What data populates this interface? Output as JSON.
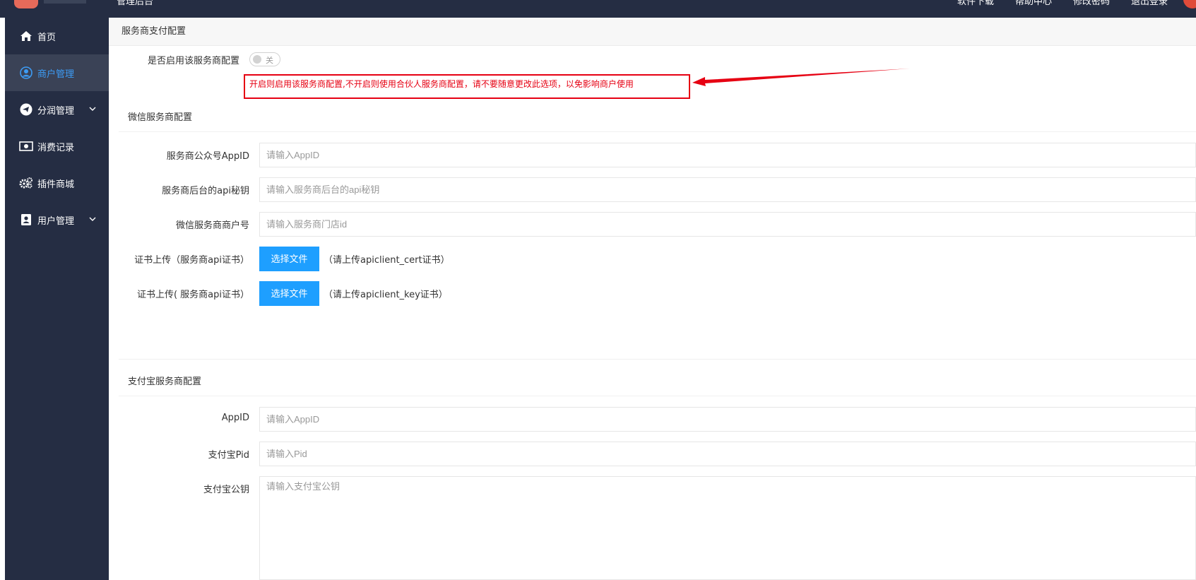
{
  "topbar": {
    "title": "管理后台",
    "links": [
      "软件下载",
      "帮助中心",
      "修改密码",
      "退出登录"
    ]
  },
  "sidebar": {
    "items": [
      {
        "label": "首页",
        "icon": "home-icon"
      },
      {
        "label": "商户管理",
        "icon": "user-circle-icon"
      },
      {
        "label": "分润管理",
        "icon": "paper-plane-icon"
      },
      {
        "label": "消费记录",
        "icon": "money-icon"
      },
      {
        "label": "插件商城",
        "icon": "gears-icon"
      },
      {
        "label": "用户管理",
        "icon": "user-card-icon"
      }
    ]
  },
  "page": {
    "title": "服务商支付配置",
    "enable_label": "是否启用该服务商配置",
    "toggle_text": "关",
    "warning": "开启则启用该服务商配置,不开启则使用合伙人服务商配置，请不要随意更改此选项，以免影响商户使用"
  },
  "wechat": {
    "title": "微信服务商配置",
    "appid_label": "服务商公众号AppID",
    "appid_placeholder": "请输入AppID",
    "secret_label": "服务商后台的api秘钥",
    "secret_placeholder": "请输入服务商后台的api秘钥",
    "mch_label": "微信服务商商户号",
    "mch_placeholder": "请输入服务商门店id",
    "cert_label": "证书上传（服务商api证书）",
    "cert_button": "选择文件",
    "cert_hint": "（请上传apiclient_cert证书）",
    "key_label": "证书上传( 服务商api证书）",
    "key_button": "选择文件",
    "key_hint": "（请上传apiclient_key证书）"
  },
  "alipay": {
    "title": "支付宝服务商配置",
    "appid_label": "AppID",
    "appid_placeholder": "请输入AppID",
    "pid_label": "支付宝Pid",
    "pid_placeholder": "请输入Pid",
    "pubkey_label": "支付宝公钥",
    "pubkey_placeholder": "请输入支付宝公钥"
  },
  "colors": {
    "sidebar_bg": "#252d43",
    "active_text": "#3d9cf5",
    "button_blue": "#1e9fff",
    "warning_red": "#e60012"
  }
}
